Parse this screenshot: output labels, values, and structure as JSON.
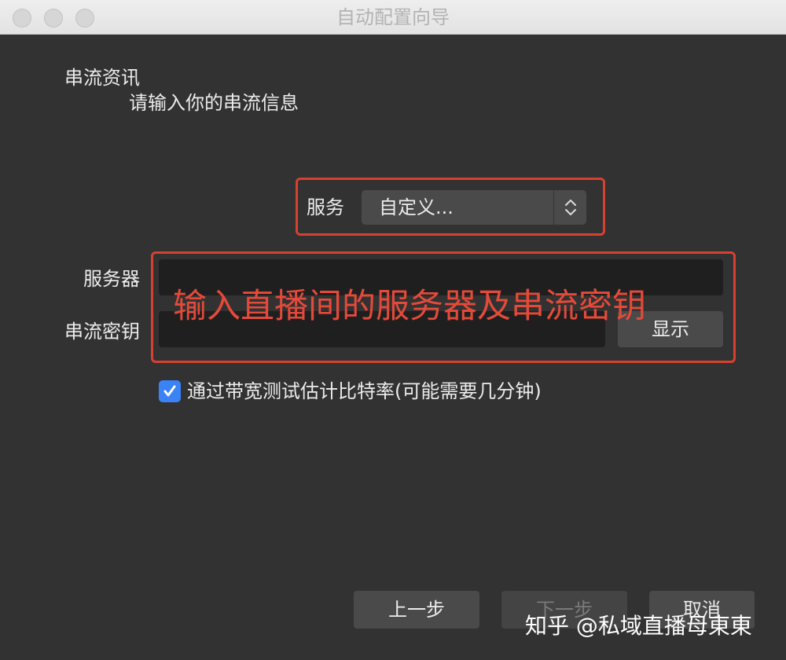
{
  "window": {
    "title": "自动配置向导"
  },
  "header": {
    "heading": "串流资讯",
    "subheading": "请输入你的串流信息"
  },
  "service": {
    "label": "服务",
    "selected": "自定义..."
  },
  "server": {
    "label": "服务器",
    "value": ""
  },
  "stream_key": {
    "label": "串流密钥",
    "value": "",
    "show_label": "显示"
  },
  "annotation": {
    "text": "输入直播间的服务器及串流密钥",
    "color": "#e44a3a"
  },
  "bandwidth_test": {
    "label": "通过带宽测试估计比特率(可能需要几分钟)",
    "checked": true
  },
  "footer": {
    "back_label": "上一步",
    "next_label": "下一步",
    "cancel_label": "取消"
  },
  "watermark": {
    "text": "知乎 @私域直播母東東"
  },
  "colors": {
    "background": "#323232",
    "accent": "#3b82f6",
    "annotation_border": "#d84030"
  }
}
